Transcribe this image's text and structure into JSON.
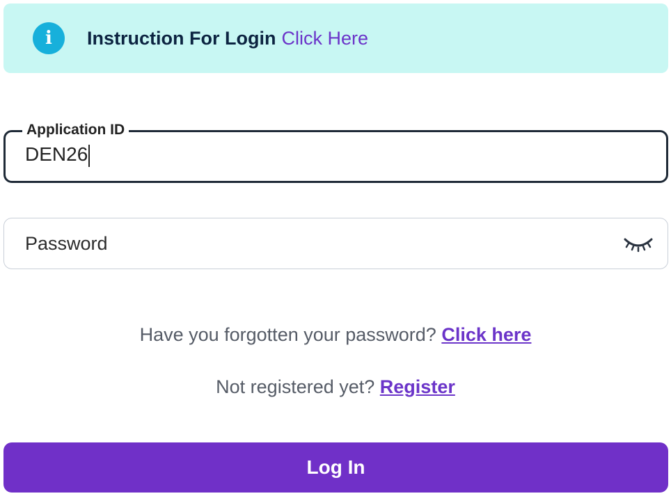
{
  "banner": {
    "icon": "info-icon",
    "icon_glyph": "i",
    "text": "Instruction For Login",
    "link": "Click Here",
    "background_color": "#c8f7f3",
    "icon_color": "#17b0db"
  },
  "application_id": {
    "label": "Application ID",
    "value": "DEN26"
  },
  "password": {
    "placeholder": "Password",
    "toggle_icon": "eye-closed-icon"
  },
  "forgot": {
    "text": "Have you forgotten your password?",
    "link": "Click here"
  },
  "register": {
    "text": "Not registered yet?",
    "link": "Register"
  },
  "login_button": {
    "label": "Log In",
    "color": "#7030c8"
  }
}
